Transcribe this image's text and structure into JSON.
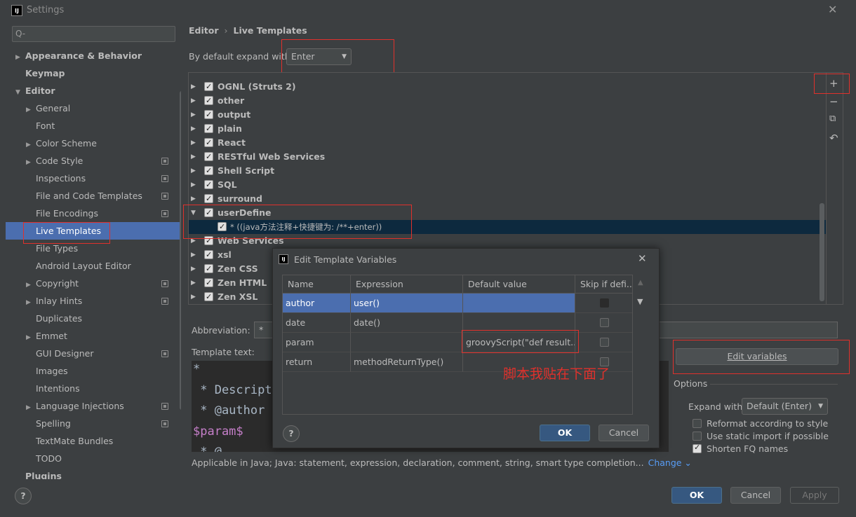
{
  "window": {
    "title": "Settings",
    "close_icon": "✕"
  },
  "search": {
    "placeholder": "Q-"
  },
  "sidebar": {
    "items": [
      {
        "label": "Appearance & Behavior",
        "arrow": "▶",
        "bold": true
      },
      {
        "label": "Keymap",
        "bold": true
      },
      {
        "label": "Editor",
        "arrow": "▼",
        "bold": true
      },
      {
        "label": "General",
        "arrow": "▶"
      },
      {
        "label": "Font"
      },
      {
        "label": "Color Scheme",
        "arrow": "▶"
      },
      {
        "label": "Code Style",
        "arrow": "▶",
        "copy": true
      },
      {
        "label": "Inspections",
        "copy": true
      },
      {
        "label": "File and Code Templates",
        "copy": true
      },
      {
        "label": "File Encodings",
        "copy": true
      },
      {
        "label": "Live Templates",
        "selected": true
      },
      {
        "label": "File Types"
      },
      {
        "label": "Android Layout Editor"
      },
      {
        "label": "Copyright",
        "arrow": "▶",
        "copy": true
      },
      {
        "label": "Inlay Hints",
        "arrow": "▶",
        "copy": true
      },
      {
        "label": "Duplicates"
      },
      {
        "label": "Emmet",
        "arrow": "▶"
      },
      {
        "label": "GUI Designer",
        "copy": true
      },
      {
        "label": "Images"
      },
      {
        "label": "Intentions"
      },
      {
        "label": "Language Injections",
        "arrow": "▶",
        "copy": true
      },
      {
        "label": "Spelling",
        "copy": true
      },
      {
        "label": "TextMate Bundles"
      },
      {
        "label": "TODO"
      },
      {
        "label": "Plugins",
        "bold": true
      }
    ]
  },
  "breadcrumb": {
    "root": "Editor",
    "sep": "›",
    "current": "Live Templates"
  },
  "expand_default": {
    "label": "By default expand with",
    "value": "Enter"
  },
  "template_groups": [
    {
      "name": "OGNL (Struts 2)"
    },
    {
      "name": "other"
    },
    {
      "name": "output"
    },
    {
      "name": "plain"
    },
    {
      "name": "React"
    },
    {
      "name": "RESTful Web Services"
    },
    {
      "name": "Shell Script"
    },
    {
      "name": "SQL"
    },
    {
      "name": "surround"
    },
    {
      "name": "userDefine",
      "expanded": true
    },
    {
      "name": "* ((java方法注释+快捷键为: /**+enter))",
      "child": true
    },
    {
      "name": "Web Services"
    },
    {
      "name": "xsl"
    },
    {
      "name": "Zen CSS"
    },
    {
      "name": "Zen HTML"
    },
    {
      "name": "Zen XSL"
    }
  ],
  "toolbar": {
    "add": "+",
    "remove": "−",
    "copy": "⧉",
    "revert": "↶"
  },
  "abbreviation": {
    "label": "Abbreviation:",
    "value": "*"
  },
  "template_text": {
    "label": "Template text:",
    "lines": [
      "*",
      " * Descript",
      " * @author",
      "$param$",
      " * @..."
    ]
  },
  "edit_variables_button": "Edit variables",
  "options": {
    "label": "Options",
    "expand_with_label": "Expand with",
    "expand_with_value": "Default (Enter)",
    "reformat": "Reformat according to style",
    "static_import": "Use static import if possible",
    "shorten_fq": "Shorten FQ names"
  },
  "applicable": {
    "text": "Applicable in Java; Java: statement, expression, declaration, comment, string, smart type completion...",
    "change": "Change ⌄"
  },
  "buttons": {
    "ok": "OK",
    "cancel": "Cancel",
    "apply": "Apply",
    "help": "?"
  },
  "dialog": {
    "title": "Edit Template Variables",
    "columns": [
      "Name",
      "Expression",
      "Default value",
      "Skip if defi..."
    ],
    "rows": [
      {
        "name": "author",
        "expression": "user()",
        "default": ""
      },
      {
        "name": "date",
        "expression": "date()",
        "default": ""
      },
      {
        "name": "param",
        "expression": "",
        "default": "groovyScript(\"def result..."
      },
      {
        "name": "return",
        "expression": "methodReturnType()",
        "default": ""
      }
    ],
    "ok": "OK",
    "cancel": "Cancel",
    "help": "?",
    "up_icon": "▲",
    "down_icon": "▼"
  },
  "annotation_note": "脚本我贴在下面了",
  "colors": {
    "accent": "#4b6eaf",
    "annotation": "#e0312c",
    "default_button": "#365880"
  }
}
